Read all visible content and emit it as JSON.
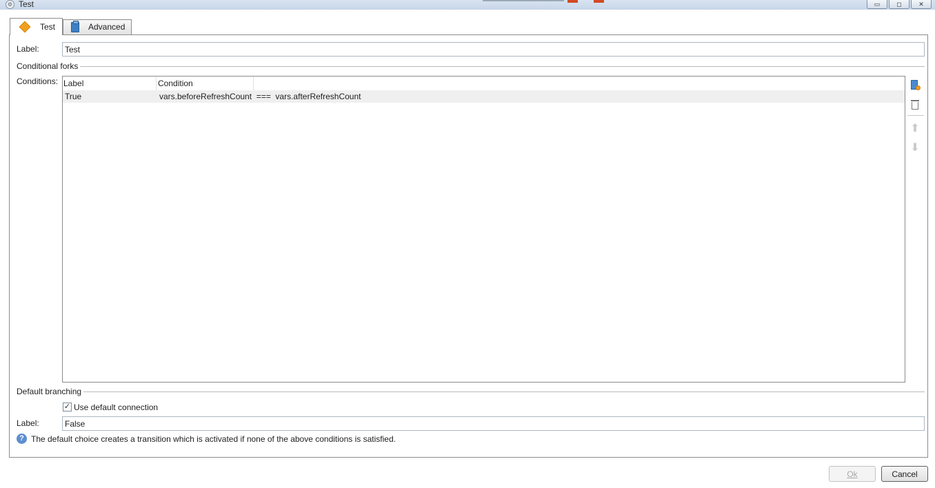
{
  "window": {
    "title": "Test",
    "minimize": "▭",
    "maximize": "◻",
    "close": "✕"
  },
  "tabs": [
    {
      "label": "Test",
      "icon": "diamond-icon",
      "color": "#f0a020",
      "active": true
    },
    {
      "label": "Advanced",
      "icon": "clipboard-icon",
      "color": "#3d7fc4",
      "active": false
    }
  ],
  "form": {
    "label_caption": "Label:",
    "label_value": "Test",
    "conditional_forks_title": "Conditional forks",
    "conditions_caption": "Conditions:"
  },
  "conditions_table": {
    "columns": [
      "Label",
      "Condition"
    ],
    "rows": [
      {
        "label": "True",
        "condition": "vars.beforeRefreshCount  ===  vars.afterRefreshCount"
      }
    ]
  },
  "default_branching": {
    "title": "Default branching",
    "use_default_label": "Use default connection",
    "use_default_checked": true,
    "label_caption": "Label:",
    "label_value": "False",
    "help_text": "The default choice creates a transition which is activated if none of the above conditions is satisfied."
  },
  "buttons": {
    "ok": "Ok",
    "cancel": "Cancel"
  }
}
